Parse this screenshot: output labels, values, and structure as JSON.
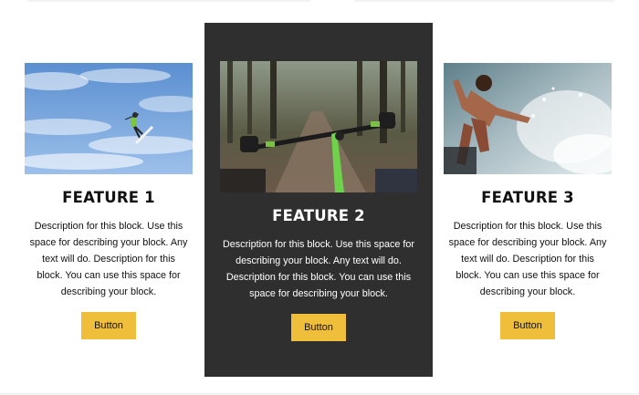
{
  "features": [
    {
      "title": "FEATURE 1",
      "description": "Description for this block. Use this space for describing your block. Any text will do. Description for this block. You can use this space for describing your block.",
      "button_label": "Button",
      "image": "kitesurfer-sky-photo"
    },
    {
      "title": "FEATURE 2",
      "description": "Description for this block. Use this space for describing your block. Any text will do. Description for this block. You can use this space for describing your block.",
      "button_label": "Button",
      "image": "mountain-bike-forest-photo"
    },
    {
      "title": "FEATURE 3",
      "description": "Description for this block. Use this space for describing your block. Any text will do. Description for this block. You can use this space for describing your block.",
      "button_label": "Button",
      "image": "surfer-wave-photo"
    }
  ],
  "colors": {
    "accent": "#efbf3c",
    "highlight_card": "#2f2f2f",
    "text": "#111111"
  }
}
